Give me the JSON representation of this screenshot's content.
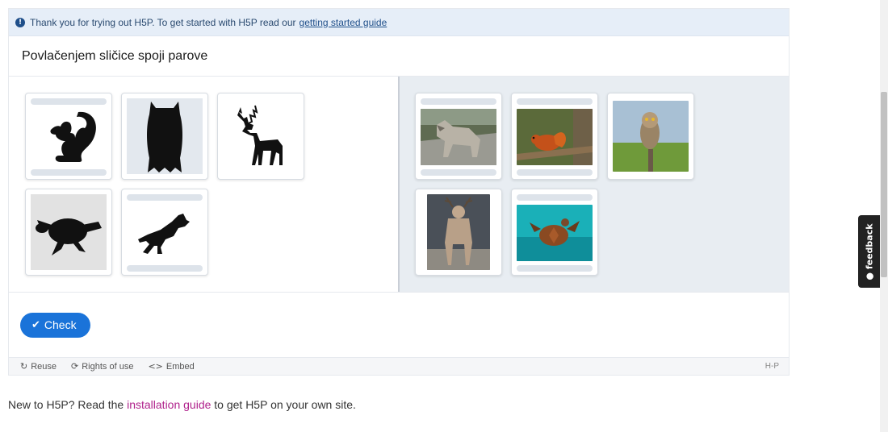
{
  "notice": {
    "text": "Thank you for trying out H5P. To get started with H5P read our",
    "link": "getting started guide"
  },
  "task": {
    "title": "Povlačenjem sličice spoji parove"
  },
  "silhouettes": [
    {
      "name": "squirrel-silhouette",
      "icon": "squirrel-icon"
    },
    {
      "name": "owl-silhouette",
      "icon": "owl-icon"
    },
    {
      "name": "deer-silhouette",
      "icon": "deer-icon"
    },
    {
      "name": "turtle-silhouette",
      "icon": "turtle-icon"
    },
    {
      "name": "wolf-silhouette",
      "icon": "wolf-icon"
    }
  ],
  "photos": [
    {
      "name": "wolf-photo"
    },
    {
      "name": "squirrel-photo"
    },
    {
      "name": "owl-photo"
    },
    {
      "name": "deer-photo"
    },
    {
      "name": "turtle-photo"
    }
  ],
  "actions": {
    "check_label": "Check"
  },
  "footer": {
    "reuse": "Reuse",
    "rights": "Rights of use",
    "embed": "Embed",
    "logo": "H-P"
  },
  "install": {
    "prefix": "New to H5P? Read the",
    "link": "installation guide",
    "suffix": "to get H5P on your own site."
  },
  "feedback": {
    "label": "feedback"
  },
  "colors": {
    "accent": "#1a73d9",
    "notice_bg": "#e6eef8",
    "link_magenta": "#b0228c"
  }
}
